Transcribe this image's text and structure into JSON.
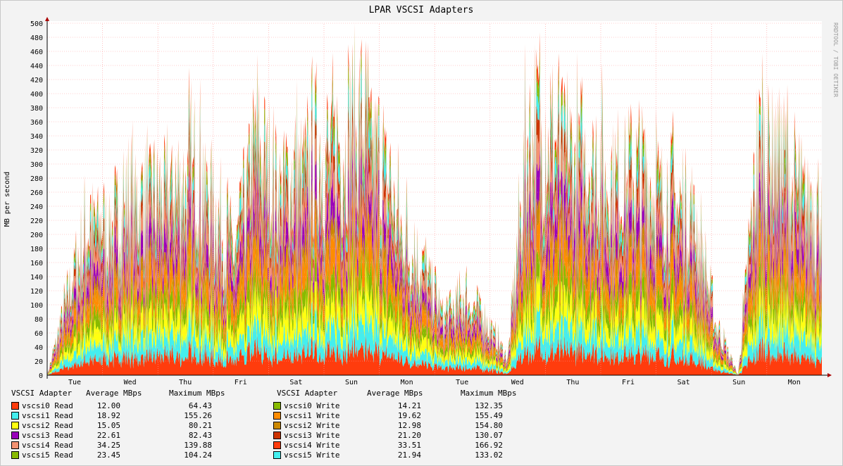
{
  "chart_data": {
    "type": "area",
    "title": "LPAR VSCSI Adapters",
    "ylabel": "MB per second",
    "watermark": "RRDTOOL / TOBI OETIKER",
    "ylim": [
      0,
      500
    ],
    "yticks": [
      0,
      20,
      40,
      60,
      80,
      100,
      120,
      140,
      160,
      180,
      200,
      220,
      240,
      260,
      280,
      300,
      320,
      340,
      360,
      380,
      400,
      420,
      440,
      460,
      480,
      500
    ],
    "xlabels": [
      "Tue",
      "Wed",
      "Thu",
      "Fri",
      "Sat",
      "Sun",
      "Mon",
      "Tue",
      "Wed",
      "Thu",
      "Fri",
      "Sat",
      "Sun",
      "Mon"
    ],
    "grid": true,
    "series": [
      {
        "name": "vscsi0 Read",
        "color": "#ff3c0d",
        "avg": "12.00",
        "max": "64.43"
      },
      {
        "name": "vscsi1 Read",
        "color": "#44eeee",
        "avg": "18.92",
        "max": "155.26"
      },
      {
        "name": "vscsi2 Read",
        "color": "#ffff11",
        "avg": "15.05",
        "max": "80.21"
      },
      {
        "name": "vscsi3 Read",
        "color": "#9900bb",
        "avg": "22.61",
        "max": "82.43"
      },
      {
        "name": "vscsi4 Read",
        "color": "#f49272",
        "avg": "34.25",
        "max": "139.88"
      },
      {
        "name": "vscsi5 Read",
        "color": "#88bb00",
        "avg": "23.45",
        "max": "104.24"
      },
      {
        "name": "vscsi0 Write",
        "color": "#88bb00",
        "avg": "14.21",
        "max": "132.35"
      },
      {
        "name": "vscsi1 Write",
        "color": "#ff8c00",
        "avg": "19.62",
        "max": "155.49"
      },
      {
        "name": "vscsi2 Write",
        "color": "#cc8800",
        "avg": "12.98",
        "max": "154.80"
      },
      {
        "name": "vscsi3 Write",
        "color": "#cc3300",
        "avg": "21.20",
        "max": "130.07"
      },
      {
        "name": "vscsi4 Write",
        "color": "#ff3c0d",
        "avg": "33.51",
        "max": "166.92"
      },
      {
        "name": "vscsi5 Write",
        "color": "#44eeee",
        "avg": "21.94",
        "max": "133.02"
      }
    ],
    "total_envelope": [
      [
        "Tue",
        0
      ],
      [
        "Tue",
        150
      ],
      [
        "Tue",
        290
      ],
      [
        "Tue",
        270
      ],
      [
        "Wed",
        330
      ],
      [
        "Wed",
        320
      ],
      [
        "Wed",
        350
      ],
      [
        "Thu",
        380
      ],
      [
        "Thu",
        310
      ],
      [
        "Thu",
        230
      ],
      [
        "Fri",
        440
      ],
      [
        "Fri",
        360
      ],
      [
        "Fri",
        380
      ],
      [
        "Sat",
        420
      ],
      [
        "Sat",
        430
      ],
      [
        "Sun",
        470
      ],
      [
        "Sun",
        400
      ],
      [
        "Sun",
        260
      ],
      [
        "Mon",
        200
      ],
      [
        "Mon",
        110
      ],
      [
        "Mon",
        150
      ],
      [
        "Mon",
        100
      ],
      [
        "Tue",
        30
      ],
      [
        "Tue",
        470
      ],
      [
        "Tue",
        440
      ],
      [
        "Wed",
        420
      ],
      [
        "Wed",
        400
      ],
      [
        "Thu",
        370
      ],
      [
        "Thu",
        380
      ],
      [
        "Fri",
        360
      ],
      [
        "Fri",
        330
      ],
      [
        "Sat",
        280
      ],
      [
        "Sat",
        90
      ],
      [
        "Sat",
        0
      ],
      [
        "Sun",
        440
      ],
      [
        "Sun",
        420
      ],
      [
        "Mon",
        330
      ],
      [
        "Mon",
        310
      ]
    ]
  },
  "legend": {
    "left_header": {
      "adapter": "VSCSI Adapter",
      "avg": "Average MBps",
      "max": "Maximum MBps"
    },
    "right_header": {
      "adapter": "VSCSI Adapter",
      "avg": "Average MBps",
      "max": "Maximum MBps"
    }
  }
}
